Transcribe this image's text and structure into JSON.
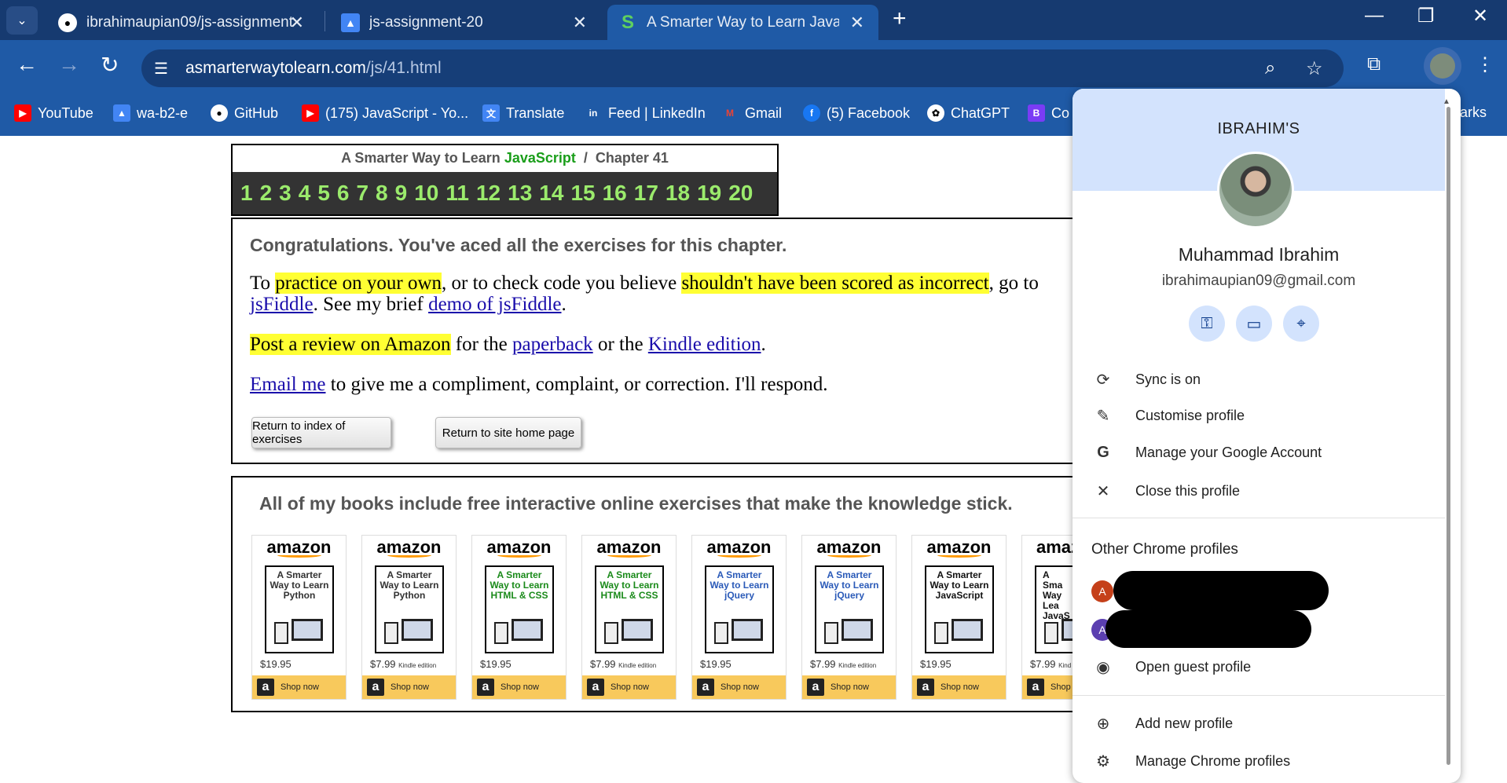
{
  "tabs": [
    {
      "title": "ibrahimaupian09/js-assignment",
      "icon": "github-icon"
    },
    {
      "title": "js-assignment-20",
      "icon": "google-classroom-icon"
    },
    {
      "title": "A Smarter Way to Learn JavaScr",
      "icon": "asmarterway-icon",
      "active": true
    }
  ],
  "url": {
    "domain": "asmarterwaytolearn.com",
    "path": "/js/41.html"
  },
  "bookmarks": [
    {
      "label": "YouTube",
      "color": "#ff0000"
    },
    {
      "label": "wa-b2-e",
      "color": "#4285f4"
    },
    {
      "label": "GitHub",
      "color": "#222222"
    },
    {
      "label": "(175) JavaScript - Yo...",
      "color": "#ff0000"
    },
    {
      "label": "Translate",
      "color": "#4285f4"
    },
    {
      "label": "Feed | LinkedIn",
      "color": "#0a66c2"
    },
    {
      "label": "Gmail",
      "color": "#ea4335"
    },
    {
      "label": "(5) Facebook",
      "color": "#1877f2"
    },
    {
      "label": "ChatGPT",
      "color": "#222222"
    },
    {
      "label": "Co",
      "color": "#7a3cf5"
    },
    {
      "label": "arks",
      "color": "#ffffff"
    }
  ],
  "chapter": {
    "title_pre": "A Smarter Way to Learn ",
    "title_js": "JavaScript",
    "title_post": "  /  Chapter 41",
    "numbers": [
      "1",
      "2",
      "3",
      "4",
      "5",
      "6",
      "7",
      "8",
      "9",
      "10",
      "11",
      "12",
      "13",
      "14",
      "15",
      "16",
      "17",
      "18",
      "19",
      "20"
    ]
  },
  "congrats": {
    "heading": "Congratulations. You've aced all the exercises for this chapter.",
    "p1_a": "To ",
    "p1_hl1": "practice on your own",
    "p1_b": ", or to check code you believe ",
    "p1_hl2": "shouldn't have been scored as incorrect",
    "p1_c": ", go to",
    "p1_link1": "jsFiddle",
    "p1_d": ". See my brief ",
    "p1_link2": "demo of jsFiddle",
    "p1_e": ".",
    "p2_hl": "Post a review on Amazon",
    "p2_a": " for the ",
    "p2_link1": "paperback",
    "p2_b": " or the ",
    "p2_link2": "Kindle edition",
    "p2_c": ".",
    "p3_link": "Email me",
    "p3_a": " to give me a compliment, complaint, or correction. I'll respond.",
    "btn_index": "Return to index of exercises",
    "btn_home": "Return to site home page"
  },
  "books": {
    "heading": "All of my books include free interactive online exercises that make the knowledge stick.",
    "amazon": "amazon",
    "shop": "Shop now",
    "items": [
      {
        "title": "A Smarter Way to Learn Python",
        "price": "$19.95",
        "edition": "",
        "color": "#333333"
      },
      {
        "title": "A Smarter Way to Learn Python",
        "price": "$7.99",
        "edition": "Kindle edition",
        "color": "#333333"
      },
      {
        "title": "A Smarter Way to Learn HTML & CSS",
        "price": "$19.95",
        "edition": "",
        "color": "#1a8a1a"
      },
      {
        "title": "A Smarter Way to Learn HTML & CSS",
        "price": "$7.99",
        "edition": "Kindle edition",
        "color": "#1a8a1a"
      },
      {
        "title": "A Smarter Way to Learn jQuery",
        "price": "$19.95",
        "edition": "",
        "color": "#2a5ab8"
      },
      {
        "title": "A Smarter Way to Learn jQuery",
        "price": "$7.99",
        "edition": "Kindle edition",
        "color": "#2a5ab8"
      },
      {
        "title": "A Smarter Way to Learn JavaScript",
        "price": "$19.95",
        "edition": "",
        "color": "#111111"
      },
      {
        "title": "A Sma Way Lea JavaS",
        "price": "$7.99",
        "edition": "Kind",
        "color": "#111111"
      }
    ]
  },
  "profile": {
    "header_name": "IBRAHIM'S",
    "full_name": "Muhammad Ibrahim",
    "email": "ibrahimaupian09@gmail.com",
    "quick_icons": [
      "key-icon",
      "card-icon",
      "location-icon"
    ],
    "items": [
      {
        "label": "Sync is on",
        "icon": "sync-icon",
        "glyph": "⟳"
      },
      {
        "label": "Customise profile",
        "icon": "pencil-icon",
        "glyph": "✎"
      },
      {
        "label": "Manage your Google Account",
        "icon": "google-icon",
        "glyph": "G"
      },
      {
        "label": "Close this profile",
        "icon": "close-icon",
        "glyph": "✕"
      }
    ],
    "other_title": "Other Chrome profiles",
    "other_profiles": [
      {
        "initial": "A",
        "color": "#c5401a"
      },
      {
        "initial": "A",
        "color": "#5b3fb0"
      }
    ],
    "guest": "Open guest profile",
    "add": "Add new profile",
    "manage": "Manage Chrome profiles"
  }
}
